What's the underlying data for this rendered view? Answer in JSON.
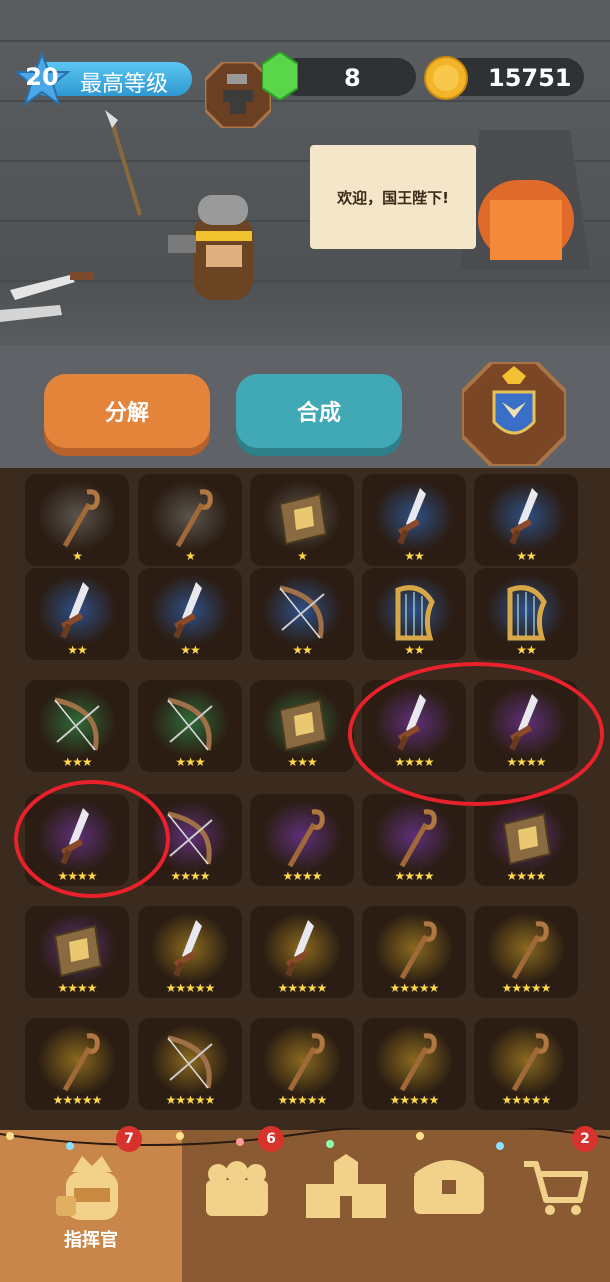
{
  "header": {
    "level": "20",
    "level_label": "最高等级",
    "gems": "8",
    "coins": "15751"
  },
  "npc": {
    "speech": "欢迎，国王陛下!"
  },
  "actions": {
    "decompose_label": "分解",
    "combine_label": "合成"
  },
  "colors": {
    "orange_button": "#e4843a",
    "teal_button": "#41a9b5",
    "annotation_circle": "#e8212b",
    "star": "#ffd84a"
  },
  "inventory": {
    "rows": [
      [
        {
          "item": "staff",
          "stars": "★",
          "glow": "gray"
        },
        {
          "item": "staff",
          "stars": "★",
          "glow": "gray"
        },
        {
          "item": "book",
          "stars": "★",
          "glow": "gray"
        },
        {
          "item": "sword",
          "stars": "★★",
          "glow": "blue"
        },
        {
          "item": "sword",
          "stars": "★★",
          "glow": "blue"
        }
      ],
      [
        {
          "item": "sword",
          "stars": "★★",
          "glow": "blue"
        },
        {
          "item": "sword",
          "stars": "★★",
          "glow": "blue"
        },
        {
          "item": "bow",
          "stars": "★★",
          "glow": "blue"
        },
        {
          "item": "harp",
          "stars": "★★",
          "glow": "blue"
        },
        {
          "item": "harp",
          "stars": "★★",
          "glow": "blue"
        }
      ],
      [
        {
          "item": "bow",
          "stars": "★★★",
          "glow": "green"
        },
        {
          "item": "bow",
          "stars": "★★★",
          "glow": "green"
        },
        {
          "item": "book",
          "stars": "★★★",
          "glow": "green"
        },
        {
          "item": "sword",
          "stars": "★★★★",
          "glow": "purple"
        },
        {
          "item": "sword",
          "stars": "★★★★",
          "glow": "purple"
        }
      ],
      [
        {
          "item": "sword",
          "stars": "★★★★",
          "glow": "purple"
        },
        {
          "item": "bow",
          "stars": "★★★★",
          "glow": "purple"
        },
        {
          "item": "staff",
          "stars": "★★★★",
          "glow": "purple"
        },
        {
          "item": "staff",
          "stars": "★★★★",
          "glow": "purple"
        },
        {
          "item": "book",
          "stars": "★★★★",
          "glow": "purple"
        }
      ],
      [
        {
          "item": "book",
          "stars": "★★★★",
          "glow": "purple"
        },
        {
          "item": "sword",
          "stars": "★★★★★",
          "glow": "gold"
        },
        {
          "item": "sword",
          "stars": "★★★★★",
          "glow": "gold"
        },
        {
          "item": "staff",
          "stars": "★★★★★",
          "glow": "gold"
        },
        {
          "item": "staff",
          "stars": "★★★★★",
          "glow": "gold"
        }
      ],
      [
        {
          "item": "staff",
          "stars": "★★★★★",
          "glow": "gold"
        },
        {
          "item": "bow",
          "stars": "★★★★★",
          "glow": "gold"
        },
        {
          "item": "staff",
          "stars": "★★★★★",
          "glow": "gold"
        },
        {
          "item": "staff",
          "stars": "★★★★★",
          "glow": "gold"
        },
        {
          "item": "staff",
          "stars": "★★★★★",
          "glow": "gold"
        }
      ]
    ]
  },
  "nav": {
    "commander_label": "指挥官",
    "badges": [
      "7",
      "6",
      "2"
    ]
  }
}
